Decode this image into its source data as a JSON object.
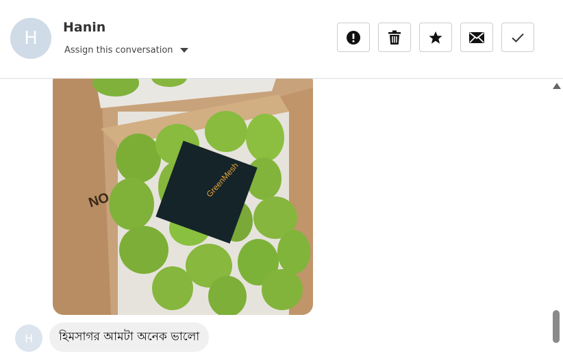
{
  "contact": {
    "avatar_initial": "H",
    "name": "Hanin"
  },
  "assign": {
    "label": "Assign this conversation"
  },
  "toolbar": {
    "actions": [
      {
        "icon": "exclamation-circle-icon"
      },
      {
        "icon": "trash-icon"
      },
      {
        "icon": "star-icon"
      },
      {
        "icon": "envelope-icon"
      },
      {
        "icon": "check-icon"
      }
    ]
  },
  "thread": {
    "photo": {
      "box_label": "NO",
      "card_text": "GreenMesh"
    },
    "message": {
      "avatar_initial": "H",
      "text": "হিমসাগর আমটা অনেক ভালো"
    }
  },
  "colors": {
    "avatar_bg": "#cfdbe6",
    "bubble_bg": "#f0f0f0",
    "border": "#c8ccd1"
  }
}
